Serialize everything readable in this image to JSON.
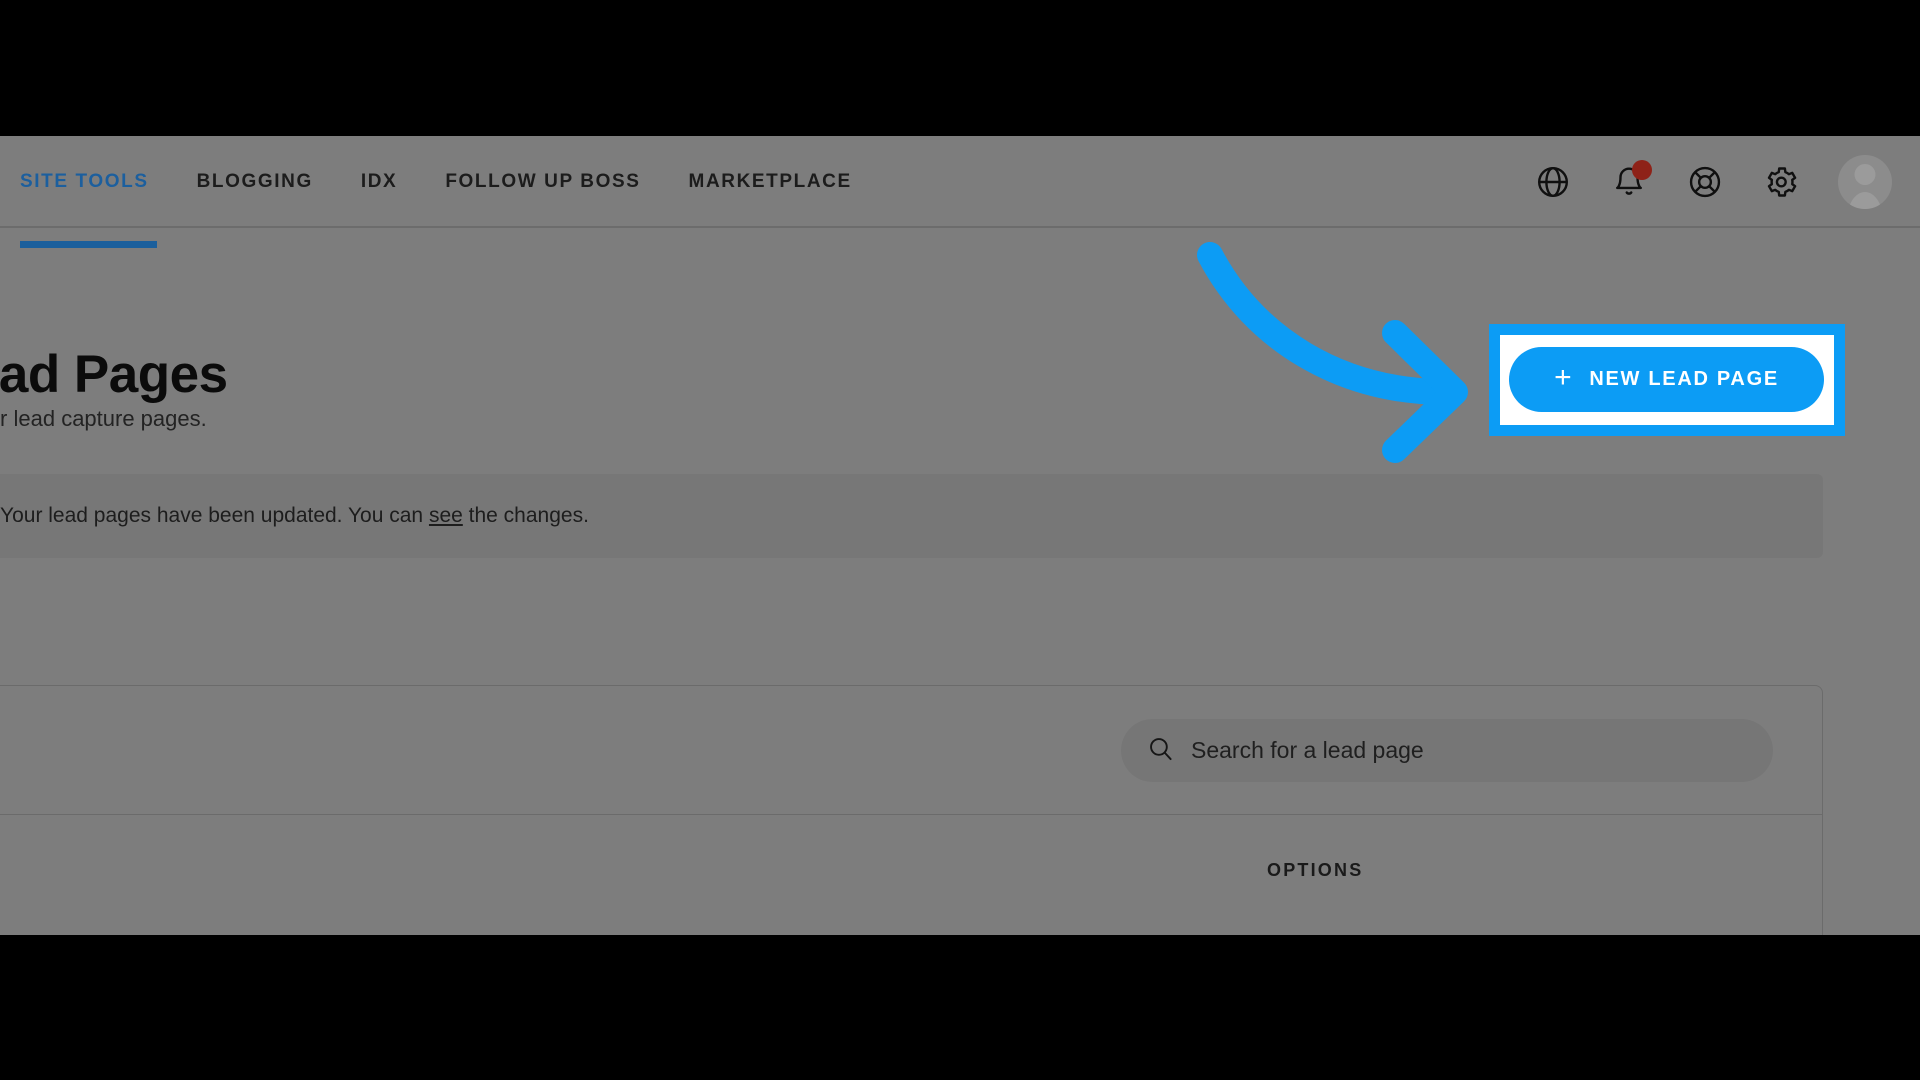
{
  "nav": {
    "tabs": [
      {
        "label": "SITE TOOLS",
        "active": true
      },
      {
        "label": "BLOGGING",
        "active": false
      },
      {
        "label": "IDX",
        "active": false
      },
      {
        "label": "FOLLOW UP BOSS",
        "active": false
      },
      {
        "label": "MARKETPLACE",
        "active": false
      }
    ],
    "icons": [
      {
        "name": "globe-icon"
      },
      {
        "name": "bell-icon",
        "badge": true
      },
      {
        "name": "lifering-help-icon"
      },
      {
        "name": "gear-settings-icon"
      },
      {
        "name": "avatar"
      }
    ]
  },
  "header": {
    "title": "Lead Pages",
    "subtitle": "Create and manage your lead capture pages."
  },
  "banner": {
    "text_before": "Your lead pages have been updated. You can ",
    "link": "see",
    "text_after": " the changes."
  },
  "search": {
    "placeholder": "Search for a lead page",
    "value": ""
  },
  "table": {
    "columns": [
      {
        "label": "OPTIONS"
      }
    ]
  },
  "action": {
    "new_lead_page_label": "NEW LEAD PAGE",
    "plus_glyph": "+"
  },
  "colors": {
    "accent_blue": "#0c9cf5",
    "nav_active_blue": "#1b5f9c",
    "badge_red": "#8e2218",
    "highlight_white": "#ffffff"
  }
}
